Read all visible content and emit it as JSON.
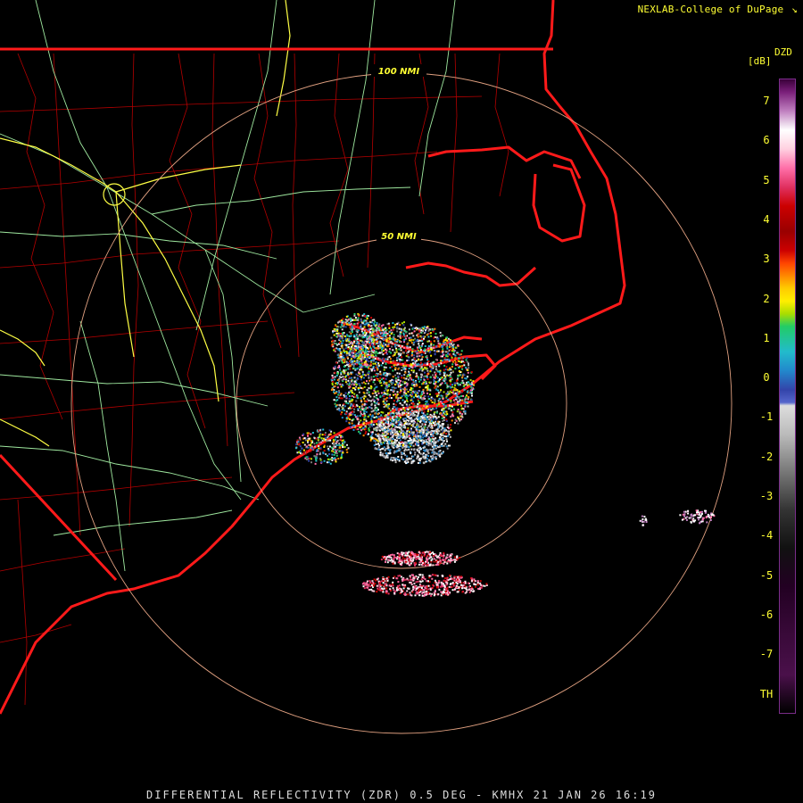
{
  "credit": {
    "text": "NEXLAB-College of DuPage",
    "logo_icon": "nexlab-arrow-icon"
  },
  "legend": {
    "product_code": "DZD",
    "units": "[dB]",
    "ticks": [
      "7",
      "6",
      "5",
      "4",
      "3",
      "2",
      "1",
      "0",
      "-1",
      "-2",
      "-3",
      "-4",
      "-5",
      "-6",
      "-7",
      "TH"
    ],
    "colors": {
      "positive_high": "#7a1f7a",
      "white": "#ffffff",
      "pink": "#ff6fa8",
      "red": "#cc0000",
      "orange": "#ff8800",
      "yellow": "#ffee00",
      "green": "#22cc66",
      "cyan": "#22bbcc",
      "blue": "#3344aa",
      "gray": "#bbbbbb",
      "dark_gray": "#333333",
      "negative_purple": "#3a0a3a"
    }
  },
  "range_rings": [
    {
      "label": "50 NMI"
    },
    {
      "label": "100 NMI"
    }
  ],
  "footer": {
    "text": "DIFFERENTIAL REFLECTIVITY (ZDR) 0.5 DEG - KMHX 21 JAN 26 16:19"
  },
  "map_colors": {
    "state_border": "#ff1a1a",
    "county_lines": "#b30000",
    "highways": "#9fe89f",
    "interstates": "#ffff44",
    "range_ring": "#e0a080"
  }
}
